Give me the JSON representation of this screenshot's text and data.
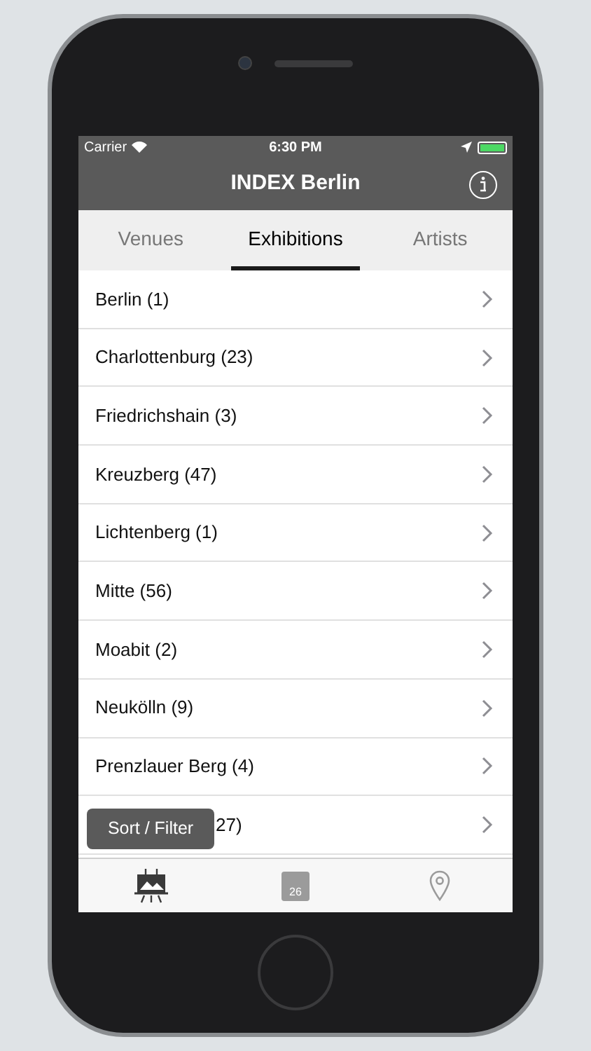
{
  "status_bar": {
    "carrier": "Carrier",
    "time": "6:30 PM"
  },
  "nav_bar": {
    "title": "INDEX Berlin"
  },
  "tabs": [
    {
      "label": "Venues",
      "selected": false
    },
    {
      "label": "Exhibitions",
      "selected": true
    },
    {
      "label": "Artists",
      "selected": false
    }
  ],
  "list": [
    {
      "label": "Berlin (1)"
    },
    {
      "label": "Charlottenburg (23)"
    },
    {
      "label": "Friedrichshain (3)"
    },
    {
      "label": "Kreuzberg (47)"
    },
    {
      "label": "Lichtenberg (1)"
    },
    {
      "label": "Mitte (56)"
    },
    {
      "label": "Moabit (2)"
    },
    {
      "label": "Neukölln (9)"
    },
    {
      "label": "Prenzlauer Berg (4)"
    },
    {
      "label": "27)",
      "kind": "covered"
    }
  ],
  "sort_filter_button": "Sort / Filter",
  "tab_bar": [
    {
      "kind": "exhibitions",
      "selected": true
    },
    {
      "kind": "calendar",
      "text": "26",
      "selected": false
    },
    {
      "kind": "map",
      "selected": false
    }
  ]
}
